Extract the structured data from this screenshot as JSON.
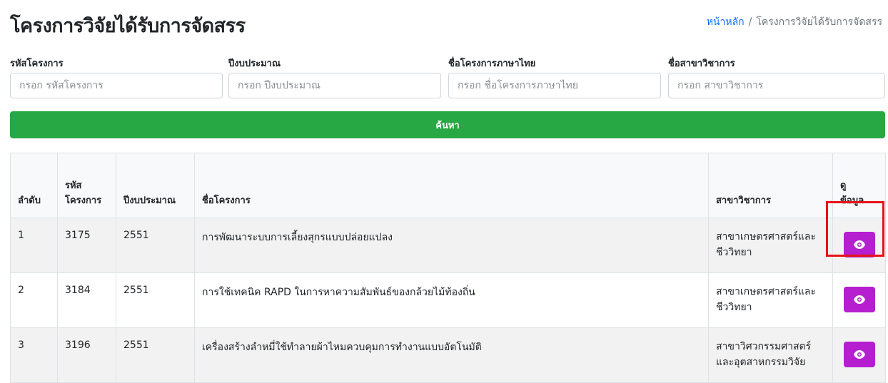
{
  "page": {
    "title": "โครงการวิจัยได้รับการจัดสรร"
  },
  "breadcrumb": {
    "home": "หน้าหลัก",
    "separator": "/",
    "current": "โครงการวิจัยได้รับการจัดสรร"
  },
  "filters": {
    "code": {
      "label": "รหัสโครงการ",
      "placeholder": "กรอก รหัสโครงการ",
      "value": ""
    },
    "year": {
      "label": "ปีงบประมาณ",
      "placeholder": "กรอก ปีงบประมาณ",
      "value": ""
    },
    "name": {
      "label": "ชื่อโครงการภาษาไทย",
      "placeholder": "กรอก ชื่อโครงการภาษาไทย",
      "value": ""
    },
    "major": {
      "label": "ชื่อสาขาวิชาการ",
      "placeholder": "กรอก สาขาวิชาการ",
      "value": ""
    }
  },
  "search_button": {
    "label": "ค้นหา",
    "color": "#28a745"
  },
  "table": {
    "headers": {
      "index": "ลำดับ",
      "code_line1": "รหัส",
      "code_line2": "โครงการ",
      "year": "ปีงบประมาณ",
      "name": "ชื่อโครงการ",
      "major": "สาขาวิชาการ",
      "view_line1": "ดู",
      "view_line2": "ข้อมูล"
    },
    "rows": [
      {
        "index": "1",
        "code": "3175",
        "year": "2551",
        "name": "การพัฒนาระบบการเลี้ยงสุกรแบบปล่อยแปลง",
        "major_line1": "สาขาเกษตรศาสตร์และ",
        "major_line2": "ชีววิทยา"
      },
      {
        "index": "2",
        "code": "3184",
        "year": "2551",
        "name": "การใช้เทคนิค RAPD ในการหาความสัมพันธ์ของกล้วยไม้ท้องถิ่น",
        "major_line1": "สาขาเกษตรศาสตร์และ",
        "major_line2": "ชีววิทยา"
      },
      {
        "index": "3",
        "code": "3196",
        "year": "2551",
        "name": "เครื่องสร้างลำหมี่ใช้ทำลายผ้าไหมควบคุมการทำงานแบบอัตโนมัติ",
        "major_line1": "สาขาวิศวกรรมศาสตร์",
        "major_line2": "และอุตสาหกรรมวิจัย"
      }
    ]
  },
  "view_button": {
    "icon": "eye-icon",
    "color": "#b51fcf"
  },
  "highlight": {
    "color": "#e8121a"
  }
}
